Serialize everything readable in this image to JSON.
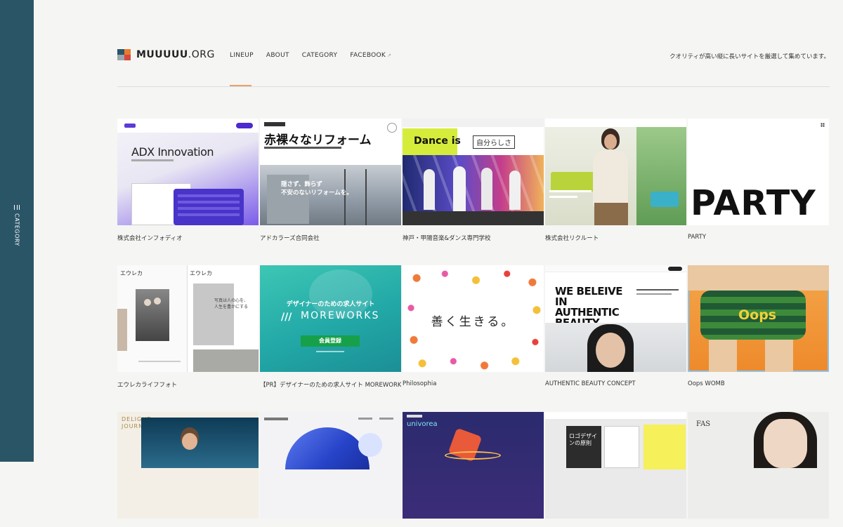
{
  "sidebar": {
    "label": "CATEGORY"
  },
  "header": {
    "logo_bold": "MUUUUU",
    "logo_rest": ".ORG",
    "nav": [
      {
        "label": "LINEUP"
      },
      {
        "label": "ABOUT"
      },
      {
        "label": "CATEGORY"
      },
      {
        "label": "FACEBOOK"
      }
    ],
    "tagline": "クオリティが高い縦に長いサイトを厳選して集めています。"
  },
  "cards": [
    {
      "caption": "株式会社インフォディオ",
      "thumb_text": "ADX Innovation"
    },
    {
      "caption": "アドカラーズ合同会社",
      "thumb_text": "赤裸々なリフォーム",
      "thumb_sub": "隠さず、飾らず\n不安のないリフォームを。"
    },
    {
      "caption": "神戸・甲陽音楽&ダンス専門学校",
      "thumb_text": "Dance is",
      "thumb_sub": "自分らしさ"
    },
    {
      "caption": "株式会社リクルート",
      "thumb_text": ""
    },
    {
      "caption": "PARTY",
      "thumb_text": "PARTY"
    },
    {
      "caption": "エウレカライフフォト",
      "thumb_text": "写真は人の心を、\n人生を豊かにする"
    },
    {
      "caption": "【PR】デザイナーのための求人サイト MOREWORKS",
      "thumb_text": "MOREWORKS",
      "thumb_sub": "デザイナーのための求人サイト",
      "thumb_btn": "会員登録"
    },
    {
      "caption": "Philosophia",
      "thumb_text": "善く生きる。"
    },
    {
      "caption": "AUTHENTIC BEAUTY CONCEPT",
      "thumb_text": "WE BELEIVE IN AUTHENTIC BEAUTY"
    },
    {
      "caption": "Oops WOMB",
      "thumb_text": "Oops"
    },
    {
      "caption": "",
      "thumb_text": "DELIGHT JOURNEY"
    },
    {
      "caption": "",
      "thumb_text": ""
    },
    {
      "caption": "",
      "thumb_text": "univorea"
    },
    {
      "caption": "",
      "thumb_text": "ロゴデザインの原則"
    },
    {
      "caption": "",
      "thumb_text": "FAS"
    }
  ]
}
